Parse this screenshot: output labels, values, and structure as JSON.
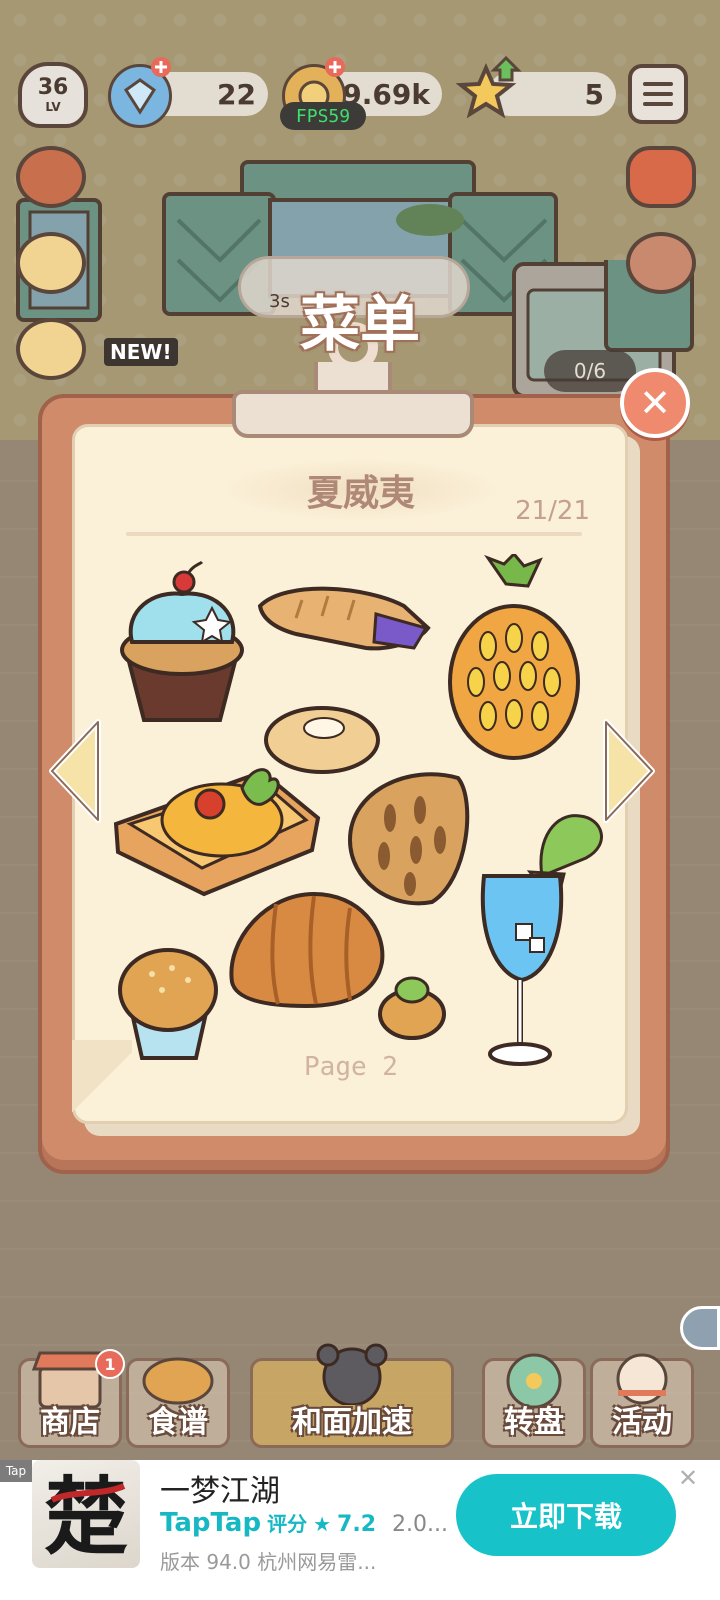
{
  "hud": {
    "level": "36",
    "level_label": "LV",
    "gems": "22",
    "coins": "19.69k",
    "stars": "5",
    "fps": "FPS59"
  },
  "scene": {
    "new_label": "NEW!",
    "timer": "3s",
    "counter": "0/6"
  },
  "menu": {
    "title": "菜单",
    "region": "夏威夷",
    "count": "21/21",
    "page": "Page 2",
    "items": [
      "blue-cream-cupcake-icon",
      "taro-turnover-icon",
      "pineapple-bun-icon",
      "cream-bun-icon",
      "egg-tomato-toast-icon",
      "herb-focaccia-icon",
      "blue-cocktail-icon",
      "muffin-icon",
      "butter-roll-icon",
      "matcha-puff-icon"
    ]
  },
  "nav": [
    {
      "label": "商店",
      "badge": "1"
    },
    {
      "label": "食谱"
    },
    {
      "label": "和面加速"
    },
    {
      "label": "转盘"
    },
    {
      "label": "活动"
    }
  ],
  "ad": {
    "tag": "Tap",
    "title": "一梦江湖",
    "brand": "TapTap",
    "rating_label": "评分",
    "rating_star": "★",
    "rating": "7.2",
    "extra": "2.0...",
    "sub": "版本 94.0   杭州网易雷...",
    "cta": "立即下载",
    "close": "✕",
    "icon_glyph": "楚"
  },
  "colors": {
    "board": "#d08c6a",
    "paper": "#fbf0d8",
    "close_button": "#f08a6e",
    "cta": "#17c3c8",
    "taptap": "#16b8c4"
  }
}
